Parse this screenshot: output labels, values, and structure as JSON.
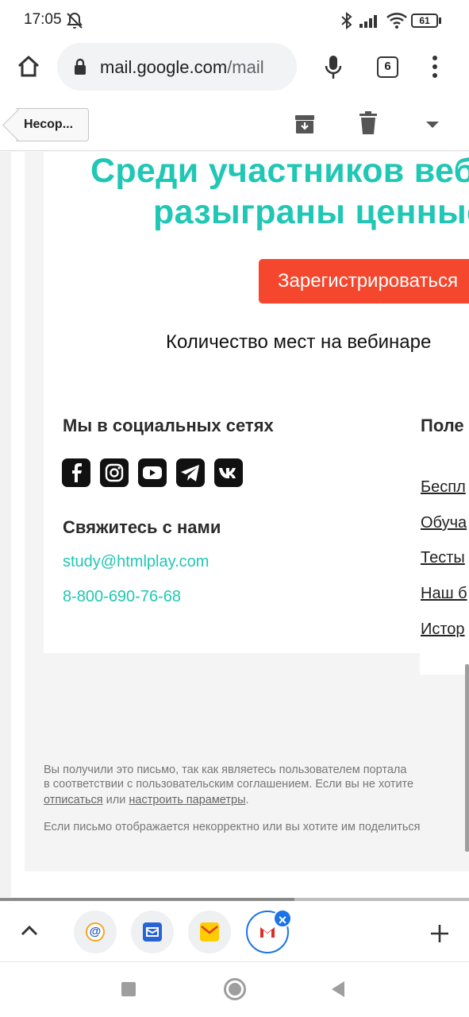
{
  "status_bar": {
    "time": "17:05",
    "battery": "61"
  },
  "browser": {
    "url_host": "mail.google.com",
    "url_path": "/mail",
    "tab_count": "6"
  },
  "gmail_toolbar": {
    "back_label": "Несор..."
  },
  "email": {
    "headline_line1": "Среди участников веб",
    "headline_line2": "разыграны ценные",
    "register_button": "Зарегистрироваться",
    "seats_text": "Количество мест на вебинаре",
    "social_title": "Мы в социальных сетях",
    "social_icons": [
      "facebook-icon",
      "instagram-icon",
      "youtube-icon",
      "telegram-icon",
      "vk-icon"
    ],
    "contact_title": "Свяжитесь с нами",
    "contact_email": "study@htmlplay.com",
    "contact_phone": "8-800-690-76-68",
    "useful_title": "Поле",
    "useful_links": [
      "Беспл",
      "Обуча",
      "Тесты",
      "Наш б",
      "Истор"
    ],
    "footer_line1": "Вы получили это письмо, так как являетесь пользователем портала",
    "footer_line2": "в соответствии с пользовательским соглашением. Если вы не хотите",
    "footer_unsubscribe": "отписаться",
    "footer_or": "или",
    "footer_settings": "настроить параметры",
    "footer_dot": ".",
    "footer_line4": "Если письмо отображается некорректно или вы хотите им поделиться"
  },
  "colors": {
    "accent_teal": "#20c7b4",
    "button_red": "#f4472d",
    "chrome_blue": "#1a73e8"
  }
}
